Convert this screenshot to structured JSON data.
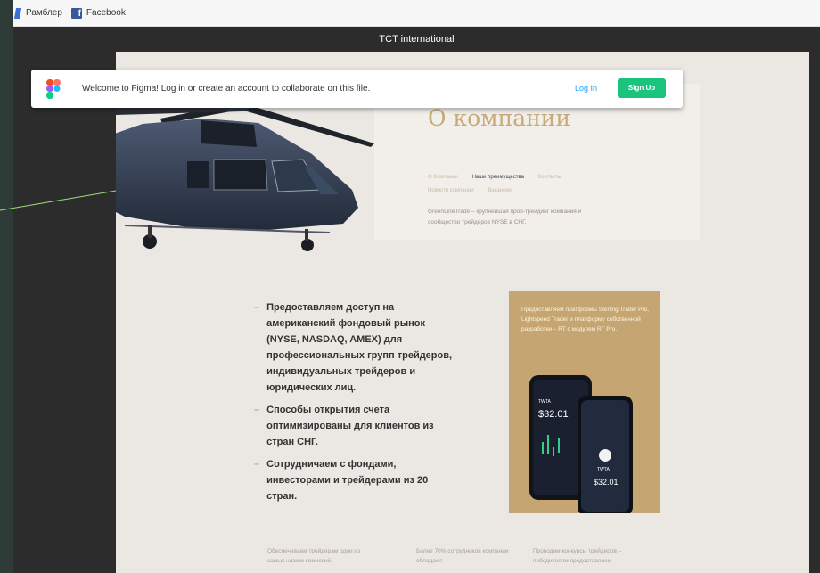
{
  "bookmarks": [
    {
      "label": "Рамблер",
      "icon": "rambler-icon"
    },
    {
      "label": "Facebook",
      "icon": "facebook-icon"
    }
  ],
  "frame": {
    "title": "TCT international"
  },
  "banner": {
    "message": "Welcome to Figma! Log in or create an account to collaborate on this file.",
    "login_label": "Log In",
    "signup_label": "Sign Up",
    "signup_color": "#1bc47d",
    "login_color": "#18a0fb"
  },
  "about": {
    "title": "О компании",
    "nav": [
      "О Компании",
      "Наши преимущества",
      "Контакты",
      "Новости компании",
      "Вакансии"
    ],
    "active_nav": "Наши преимущества",
    "description": "GreenLineTrade – крупнейшая проп-трейдинг компания и сообщество трейдеров NYSE в СНГ."
  },
  "bullets": [
    "Предоставляем доступ на американский фондовый рынок (NYSE, NASDAQ, AMEX) для профессиональных групп трейдеров, индивидуальных трейдеров и юридических лиц.",
    "Способы открытия счета оптимизированы для клиентов из стран СНГ.",
    "Сотрудничаем с фондами, инвесторами и трейдерами из 20 стран."
  ],
  "promo": {
    "text": "Предоставляем платформы Sterling Trader Pro, Lightspeed Trader и платформу собственной разработки – RT с модулем RT Pro.",
    "phone_brand": "TWTA",
    "phone_value": "$32.01",
    "color": "#c5a672"
  },
  "bottom_columns": [
    "Обеспечиваем трейдерам одни из самых низких комиссий,",
    "Более 70% сотрудников компании обладают",
    "Проводим конкурсы трейдеров – победителям предоставляем"
  ],
  "colors": {
    "accent": "#c6ab79",
    "canvas": "#ebe7e3",
    "frame": "#2c2c2c"
  }
}
